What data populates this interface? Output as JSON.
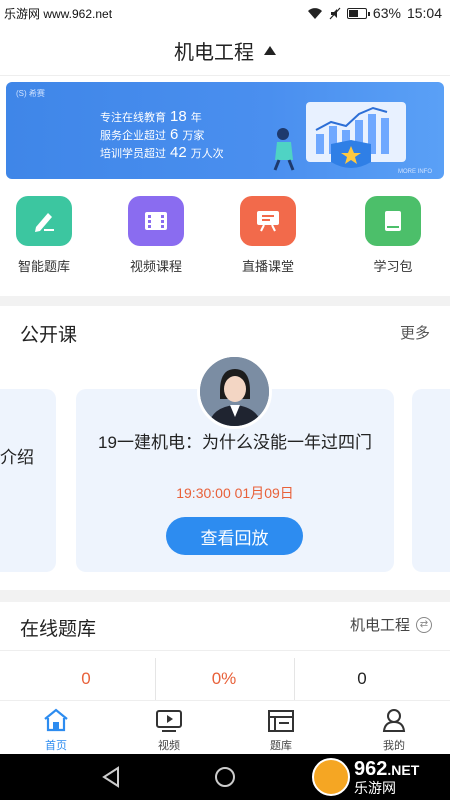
{
  "status_bar": {
    "watermark": "乐游网 www.962.net",
    "battery": "63%",
    "time": "15:04",
    "battery_level": 0.63
  },
  "header": {
    "title": "机电工程"
  },
  "banner": {
    "brand": "(S) 希赛",
    "line1_pre": "专注在线教育",
    "line1_num": "18",
    "line1_post": "年",
    "line2_pre": "服务企业超过",
    "line2_num": "6",
    "line2_post": "万家",
    "line3_pre": "培训学员超过",
    "line3_num": "42",
    "line3_post": "万人次",
    "fine_print": "MORE INFO"
  },
  "features": [
    {
      "label": "智能题库",
      "color": "#3cc6a0"
    },
    {
      "label": "视频课程",
      "color": "#8a6cf0"
    },
    {
      "label": "直播课堂",
      "color": "#f26a4b"
    },
    {
      "label": "学习包",
      "color": "#4cbf6a"
    }
  ],
  "open_courses": {
    "title": "公开课",
    "more": "更多",
    "peek_left": "介绍",
    "card": {
      "title": "19一建机电：为什么没能一年过四门",
      "time": "19:30:00  01月09日",
      "button": "查看回放"
    }
  },
  "question_bank": {
    "title": "在线题库",
    "subject": "机电工程",
    "stats": [
      {
        "value": "0",
        "color": "#e8613a"
      },
      {
        "value": "0%",
        "color": "#e8613a"
      },
      {
        "value": "0",
        "color": "#222222"
      }
    ]
  },
  "tabs": [
    {
      "label": "首页",
      "icon": "home-icon"
    },
    {
      "label": "视频",
      "icon": "video-icon"
    },
    {
      "label": "题库",
      "icon": "question-bank-icon"
    },
    {
      "label": "我的",
      "icon": "profile-icon"
    }
  ],
  "nav_watermark": {
    "big": "962",
    "net": ".NET",
    "sub": "乐游网"
  },
  "colors": {
    "accent": "#2d8cf0",
    "highlight": "#e8613a"
  }
}
